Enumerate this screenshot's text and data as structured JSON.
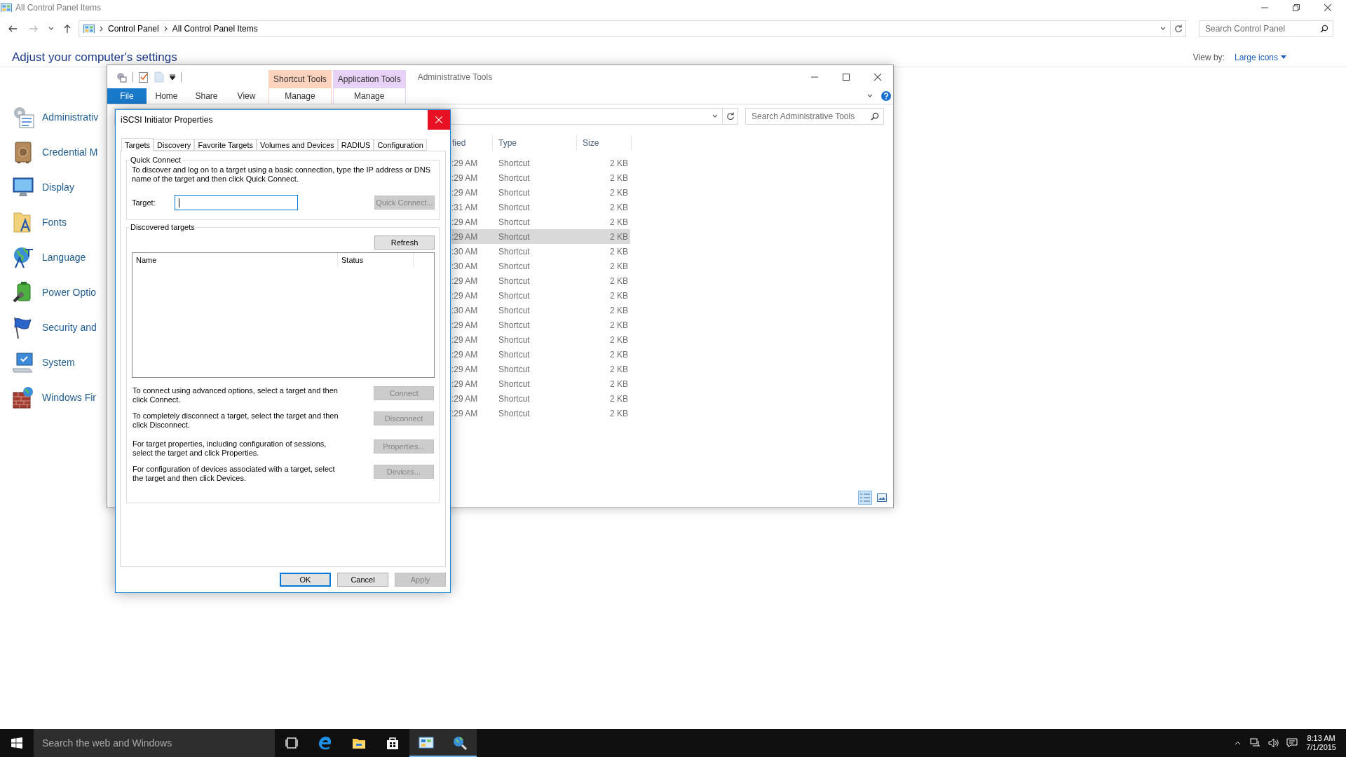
{
  "control_panel": {
    "title": "All Control Panel Items",
    "breadcrumb": [
      "Control Panel",
      "All Control Panel Items"
    ],
    "search": {
      "placeholder": "Search Control Panel"
    },
    "heading": "Adjust your computer's settings",
    "view_by": {
      "label": "View by:",
      "value": "Large icons"
    },
    "items": [
      {
        "label": "Administrativ",
        "kind": "admin"
      },
      {
        "label": "Credential M",
        "kind": "credential"
      },
      {
        "label": "Display",
        "kind": "display"
      },
      {
        "label": "Fonts",
        "kind": "fonts"
      },
      {
        "label": "Language",
        "kind": "language"
      },
      {
        "label": "Power Optio",
        "kind": "power"
      },
      {
        "label": "Security and",
        "kind": "security"
      },
      {
        "label": "System",
        "kind": "system"
      },
      {
        "label": "Windows Fir",
        "kind": "firewall"
      }
    ]
  },
  "explorer": {
    "title": "Administrative Tools",
    "context_tabs": [
      {
        "header": "Shortcut Tools",
        "tab": "Manage",
        "color": "#fdd3bd"
      },
      {
        "header": "Application Tools",
        "tab": "Manage",
        "color": "#e7d1f7"
      }
    ],
    "ribbon_tabs": [
      {
        "label": "File",
        "kind": "file"
      },
      {
        "label": "Home",
        "kind": "tab"
      },
      {
        "label": "Share",
        "kind": "tab"
      },
      {
        "label": "View",
        "kind": "tab"
      }
    ],
    "search": {
      "placeholder": "Search Administrative Tools"
    },
    "columns": [
      "fied",
      "Type",
      "Size"
    ],
    "rows": [
      {
        "cells": [
          ":29 AM",
          "Shortcut",
          "2 KB"
        ],
        "selected": false
      },
      {
        "cells": [
          ":29 AM",
          "Shortcut",
          "2 KB"
        ],
        "selected": false
      },
      {
        "cells": [
          ":29 AM",
          "Shortcut",
          "2 KB"
        ],
        "selected": false
      },
      {
        "cells": [
          ":31 AM",
          "Shortcut",
          "2 KB"
        ],
        "selected": false
      },
      {
        "cells": [
          ":29 AM",
          "Shortcut",
          "2 KB"
        ],
        "selected": false
      },
      {
        "cells": [
          ":29 AM",
          "Shortcut",
          "2 KB"
        ],
        "selected": true
      },
      {
        "cells": [
          ":30 AM",
          "Shortcut",
          "2 KB"
        ],
        "selected": false
      },
      {
        "cells": [
          ":30 AM",
          "Shortcut",
          "2 KB"
        ],
        "selected": false
      },
      {
        "cells": [
          ":29 AM",
          "Shortcut",
          "2 KB"
        ],
        "selected": false
      },
      {
        "cells": [
          ":29 AM",
          "Shortcut",
          "2 KB"
        ],
        "selected": false
      },
      {
        "cells": [
          ":30 AM",
          "Shortcut",
          "2 KB"
        ],
        "selected": false
      },
      {
        "cells": [
          ":29 AM",
          "Shortcut",
          "2 KB"
        ],
        "selected": false
      },
      {
        "cells": [
          ":29 AM",
          "Shortcut",
          "2 KB"
        ],
        "selected": false
      },
      {
        "cells": [
          ":29 AM",
          "Shortcut",
          "2 KB"
        ],
        "selected": false
      },
      {
        "cells": [
          ":29 AM",
          "Shortcut",
          "2 KB"
        ],
        "selected": false
      },
      {
        "cells": [
          ":29 AM",
          "Shortcut",
          "2 KB"
        ],
        "selected": false
      },
      {
        "cells": [
          ":29 AM",
          "Shortcut",
          "2 KB"
        ],
        "selected": false
      },
      {
        "cells": [
          ":29 AM",
          "Shortcut",
          "2 KB"
        ],
        "selected": false
      }
    ]
  },
  "dialog": {
    "title": "iSCSI Initiator Properties",
    "tabs": [
      {
        "label": "Targets",
        "selected": true
      },
      {
        "label": "Discovery",
        "selected": false
      },
      {
        "label": "Favorite Targets",
        "selected": false
      },
      {
        "label": "Volumes and Devices",
        "selected": false
      },
      {
        "label": "RADIUS",
        "selected": false
      },
      {
        "label": "Configuration",
        "selected": false
      }
    ],
    "quick_connect": {
      "legend": "Quick Connect",
      "description": "To discover and log on to a target using a basic connection, type the IP address or DNS name of the target and then click Quick Connect.",
      "target_label": "Target:",
      "button": {
        "label": "Quick Connect...",
        "disabled": true
      }
    },
    "discovered": {
      "legend": "Discovered targets",
      "refresh": {
        "label": "Refresh",
        "disabled": false
      },
      "columns": [
        "Name",
        "Status"
      ],
      "actions": [
        {
          "text": "To connect using advanced options, select a target and then click Connect.",
          "button": {
            "label": "Connect",
            "disabled": true
          }
        },
        {
          "text": "To completely disconnect a target, select the target and then click Disconnect.",
          "button": {
            "label": "Disconnect",
            "disabled": true
          }
        },
        {
          "text": "For target properties, including configuration of sessions, select the target and click Properties.",
          "button": {
            "label": "Properties...",
            "disabled": true
          }
        },
        {
          "text": "For configuration of devices associated with a target, select the target and then click Devices.",
          "button": {
            "label": "Devices...",
            "disabled": true
          }
        }
      ]
    },
    "buttons": [
      {
        "label": "OK",
        "disabled": false,
        "default": true
      },
      {
        "label": "Cancel",
        "disabled": false,
        "default": false
      },
      {
        "label": "Apply",
        "disabled": true,
        "default": false
      }
    ]
  },
  "taskbar": {
    "search": {
      "placeholder": "Search the web and Windows"
    },
    "apps": [
      {
        "kind": "task-view",
        "active": false
      },
      {
        "kind": "browser",
        "active": false
      },
      {
        "kind": "folder",
        "active": false
      },
      {
        "kind": "store",
        "active": false
      },
      {
        "kind": "control-panel",
        "active": true
      },
      {
        "kind": "iscsi",
        "active": true
      }
    ],
    "clock": {
      "time": "8:13 AM",
      "date": "7/1/2015"
    }
  }
}
